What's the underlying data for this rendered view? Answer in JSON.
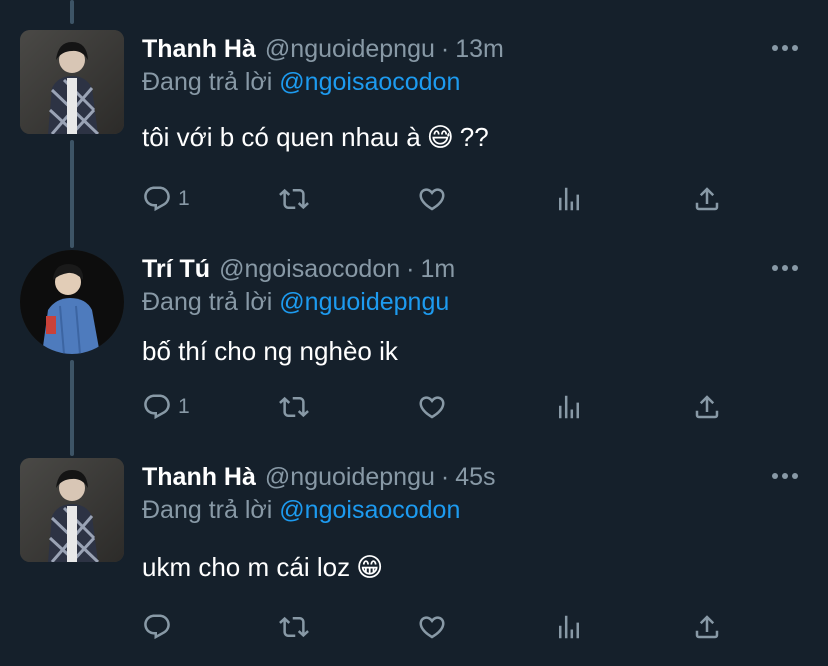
{
  "colors": {
    "background": "#15202b",
    "text_primary": "#ffffff",
    "text_secondary": "#8899a6",
    "mention": "#1d9bf0",
    "thread_line": "#3d5466"
  },
  "tweets": [
    {
      "name": "Thanh Hà",
      "handle": "@nguoidepngu",
      "separator": "·",
      "time": "13m",
      "reply_prefix": "Đang trả lời",
      "reply_to": "@ngoisaocodon",
      "text": "tôi với b có quen nhau à",
      "emoji": "😅",
      "text_suffix": "??",
      "reply_count": "1",
      "avatar": "photo-person-plaid-shirt"
    },
    {
      "name": "Trí Tú",
      "handle": "@ngoisaocodon",
      "separator": "·",
      "time": "1m",
      "reply_prefix": "Đang trả lời",
      "reply_to": "@nguoidepngu",
      "text": "bố thí cho ng nghèo ik",
      "emoji": "",
      "text_suffix": "",
      "reply_count": "1",
      "avatar": "photo-person-blue-shirt"
    },
    {
      "name": "Thanh Hà",
      "handle": "@nguoidepngu",
      "separator": "·",
      "time": "45s",
      "reply_prefix": "Đang trả lời",
      "reply_to": "@ngoisaocodon",
      "text": "ukm cho m cái loz",
      "emoji": "😁",
      "text_suffix": "",
      "reply_count": "",
      "avatar": "photo-person-plaid-shirt"
    }
  ],
  "icons": {
    "reply": "reply-icon",
    "retweet": "retweet-icon",
    "like": "heart-icon",
    "analytics": "analytics-icon",
    "share": "share-icon",
    "more": "more-icon"
  }
}
